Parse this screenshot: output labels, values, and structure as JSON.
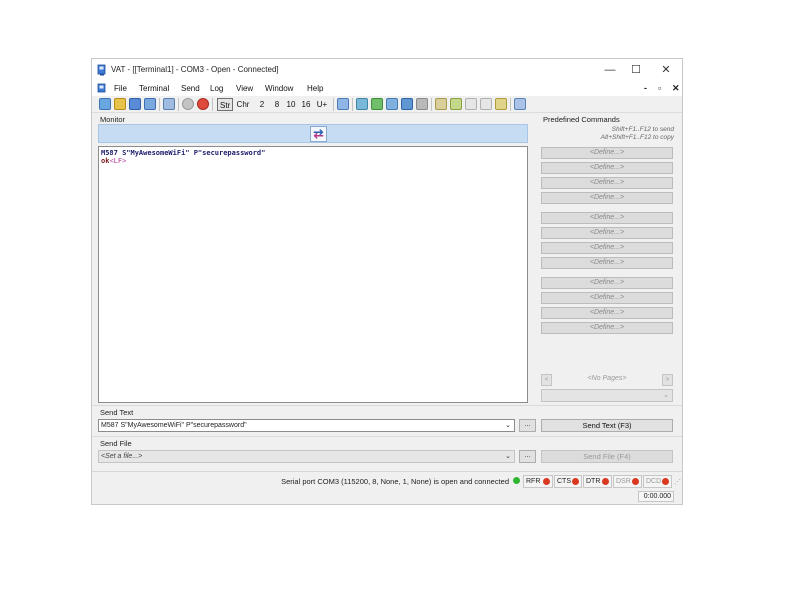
{
  "window": {
    "title": "VAT - [[Terminal1] - COM3 - Open - Connected]",
    "controls": {
      "minimize": "—",
      "maximize": "☐",
      "close": "✕"
    }
  },
  "menu": {
    "items": [
      "File",
      "Terminal",
      "Send",
      "Log",
      "View",
      "Window",
      "Help"
    ],
    "mdi": {
      "minimize": "-",
      "restore": "▫",
      "close": "✕"
    }
  },
  "toolbar": {
    "modes": {
      "str": "Str",
      "chr": "Chr"
    },
    "bases": [
      "2",
      "8",
      "10",
      "16",
      "U+"
    ]
  },
  "monitor": {
    "label": "Monitor",
    "lines": {
      "line1": "M587 S\"MyAwesomeWiFi\" P\"securepassword\"",
      "line2_ok": "ok",
      "line2_lf": "<LF>"
    }
  },
  "predefined": {
    "label": "Predefined Commands",
    "hint1": "Shift+F1..F12 to send",
    "hint2": "Alt+Shift+F1..F12 to copy",
    "define_label": "<Define...>",
    "pager_label": "<No Pages>",
    "pager_prev": "<",
    "pager_next": ">",
    "page_chevron": "⌄"
  },
  "send_text": {
    "label": "Send Text",
    "value": "M587 S\"MyAwesomeWiFi\" P\"securepassword\"",
    "browse": "...",
    "button": "Send Text (F3)"
  },
  "send_file": {
    "label": "Send File",
    "placeholder": "<Set a file...>",
    "browse": "...",
    "button": "Send File (F4)"
  },
  "status": {
    "text": "Serial port COM3 (115200, 8, None, 1, None) is open and connected",
    "indicators": [
      {
        "label": "RFR",
        "color": "#d9381e"
      },
      {
        "label": "CTS",
        "color": "#d9381e"
      },
      {
        "label": "DTR",
        "color": "#d9381e"
      },
      {
        "label": "DSR",
        "color": "#d9381e"
      },
      {
        "label": "DCD",
        "color": "#d9381e"
      }
    ],
    "connected_color": "#2fb52f",
    "timer": "0:00.000"
  },
  "colors": {
    "monitor_bar": "#c6dcf3",
    "accent": "#2a5fb0"
  }
}
